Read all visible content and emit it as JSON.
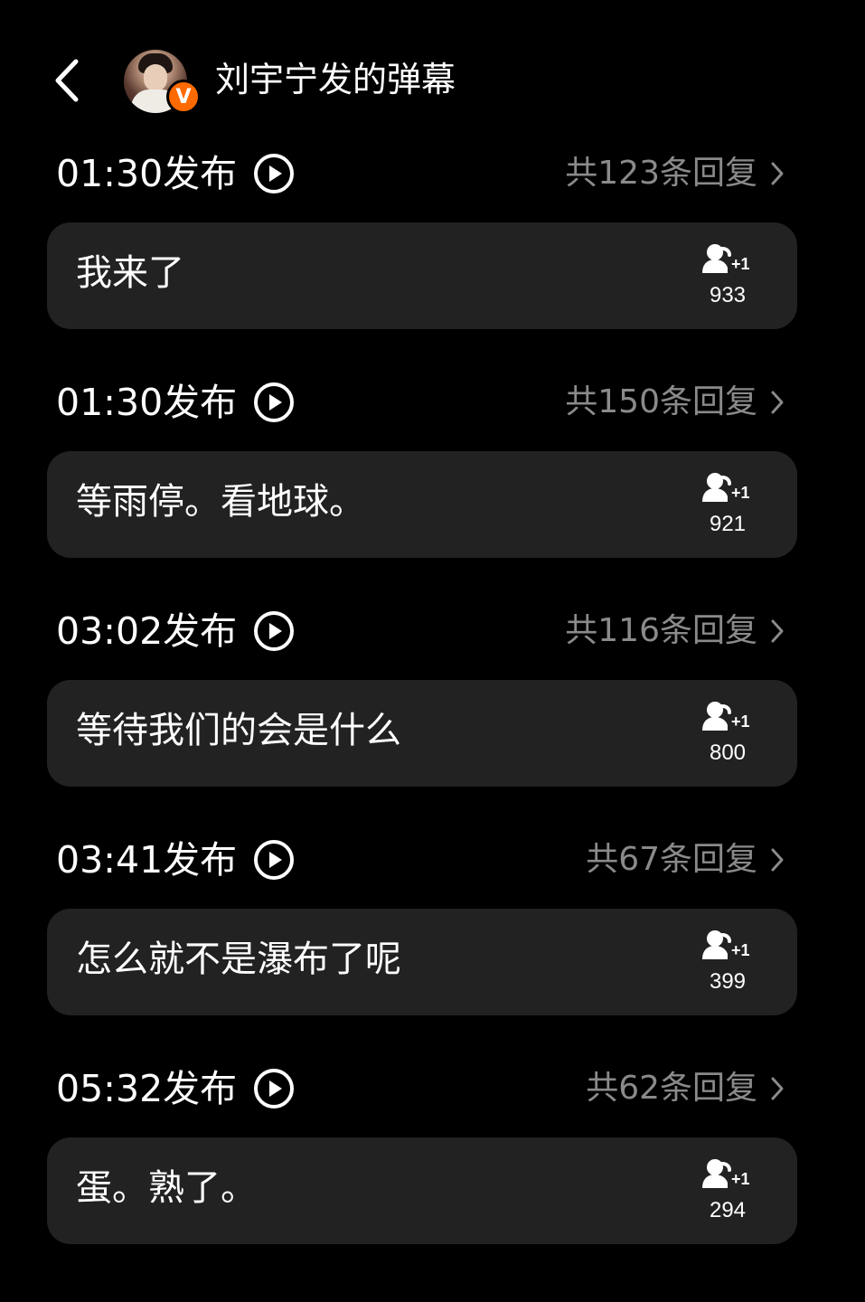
{
  "header": {
    "title": "刘宇宁发的弹幕",
    "badge_letter": "V"
  },
  "colors": {
    "background": "#000000",
    "bubble": "#222222",
    "muted_text": "#8a8a8a",
    "badge": "#ff6a00"
  },
  "danmaku": [
    {
      "time": "01:30发布",
      "replies": "共123条回复",
      "text": "我来了",
      "plus_count": "933"
    },
    {
      "time": "01:30发布",
      "replies": "共150条回复",
      "text": "等雨停。看地球。",
      "plus_count": "921"
    },
    {
      "time": "03:02发布",
      "replies": "共116条回复",
      "text": "等待我们的会是什么",
      "plus_count": "800"
    },
    {
      "time": "03:41发布",
      "replies": "共67条回复",
      "text": "怎么就不是瀑布了呢",
      "plus_count": "399"
    },
    {
      "time": "05:32发布",
      "replies": "共62条回复",
      "text": "蛋。熟了。",
      "plus_count": "294"
    }
  ]
}
